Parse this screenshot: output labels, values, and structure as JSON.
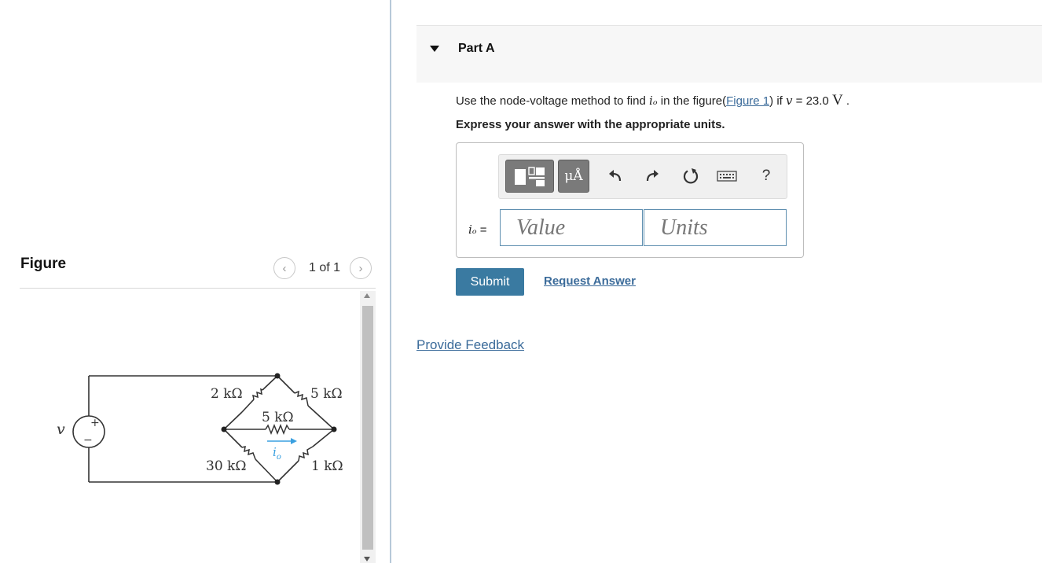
{
  "figure_panel": {
    "title": "Figure",
    "pager_label": "1 of 1",
    "prev_icon": "chevron-left-icon",
    "next_icon": "chevron-right-icon",
    "circuit": {
      "source_label": "v",
      "plus_sign": "+",
      "minus_sign": "−",
      "r_top_left": "2 kΩ",
      "r_top_right": "5 kΩ",
      "r_middle": "5 kΩ",
      "r_bottom_left": "30 kΩ",
      "r_bottom_right": "1 kΩ",
      "current_label": "i",
      "current_subscript": "o",
      "current_color": "#3aa0e0"
    }
  },
  "part": {
    "title": "Part A",
    "question_prefix": "Use the node-voltage method to find ",
    "question_var": "iₒ",
    "question_mid": " in the figure(",
    "figure_link": "Figure 1",
    "question_mid2": ") if ",
    "voltage_var": "v",
    "voltage_value": " = 23.0 ",
    "voltage_unit": "V",
    "question_end": " .",
    "instruction": "Express your answer with the appropriate units."
  },
  "answer": {
    "var_label": "iₒ",
    "equals": "=",
    "value_placeholder": "Value",
    "units_placeholder": "Units",
    "toolbar": {
      "units_button_label": "μÅ",
      "help_label": "?",
      "icons": [
        "templates-icon",
        "units-icon",
        "undo-icon",
        "redo-icon",
        "reset-icon",
        "keyboard-icon",
        "help-icon"
      ]
    }
  },
  "actions": {
    "submit_label": "Submit",
    "request_answer_label": "Request Answer",
    "feedback_label": "Provide Feedback"
  },
  "colors": {
    "accent": "#3a7aa1",
    "link": "#3b6b9a",
    "field_border": "#5f8fb0"
  }
}
